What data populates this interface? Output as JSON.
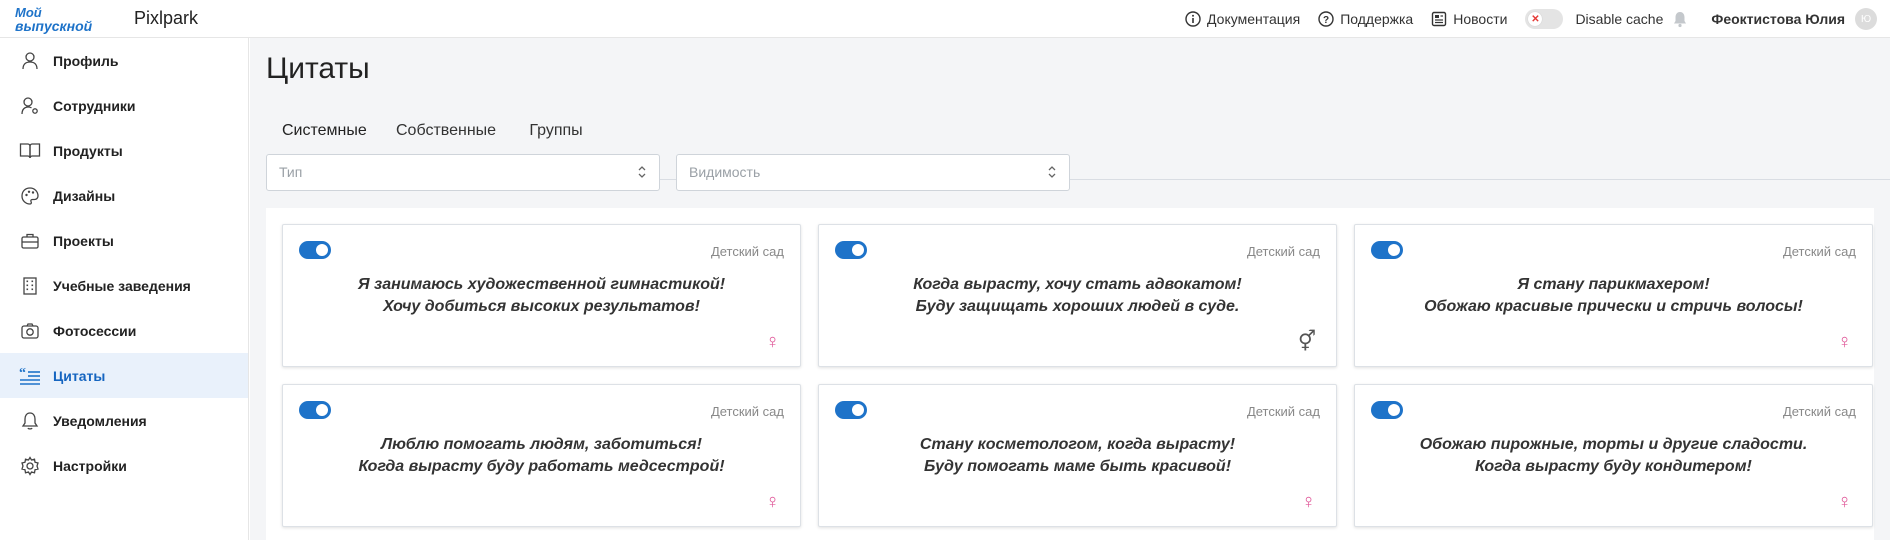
{
  "header": {
    "logo_line1": "Мой",
    "logo_line2": "выпускной",
    "app_name": "Pixlpark",
    "links": [
      {
        "label": "Документация",
        "icon": "info-icon"
      },
      {
        "label": "Поддержка",
        "icon": "help-icon"
      },
      {
        "label": "Новости",
        "icon": "news-icon"
      }
    ],
    "disable_cache_label": "Disable cache",
    "user_name": "Феоктистова Юлия",
    "avatar_initials": "Ю"
  },
  "sidebar": {
    "items": [
      {
        "label": "Профиль",
        "icon": "user-icon"
      },
      {
        "label": "Сотрудники",
        "icon": "user-settings-icon"
      },
      {
        "label": "Продукты",
        "icon": "book-icon"
      },
      {
        "label": "Дизайны",
        "icon": "palette-icon"
      },
      {
        "label": "Проекты",
        "icon": "briefcase-icon"
      },
      {
        "label": "Учебные заведения",
        "icon": "building-icon"
      },
      {
        "label": "Фотосессии",
        "icon": "camera-icon"
      },
      {
        "label": "Цитаты",
        "icon": "quote-icon",
        "active": true
      },
      {
        "label": "Уведомления",
        "icon": "bell-icon"
      },
      {
        "label": "Настройки",
        "icon": "gear-icon"
      }
    ]
  },
  "main": {
    "title": "Цитаты",
    "tabs": [
      {
        "label": "Системные",
        "active": true
      },
      {
        "label": "Собственные"
      },
      {
        "label": "Группы"
      }
    ],
    "filters": {
      "type_placeholder": "Тип",
      "visibility_placeholder": "Видимость"
    },
    "cards": [
      {
        "category": "Детский сад",
        "line1": "Я занимаюсь художественной гимнастикой!",
        "line2": "Хочу добиться высоких результатов!",
        "gender": "♀",
        "gender_name": "female",
        "enabled": true
      },
      {
        "category": "Детский сад",
        "line1": "Когда вырасту, хочу стать адвокатом!",
        "line2": "Буду защищать хороших людей в суде.",
        "gender": "⚥",
        "gender_name": "unisex",
        "enabled": true
      },
      {
        "category": "Детский сад",
        "line1": "Я стану парикмахером!",
        "line2": "Обожаю красивые прически и стричь волосы!",
        "gender": "♀",
        "gender_name": "female",
        "enabled": true
      },
      {
        "category": "Детский сад",
        "line1": "Люблю помогать людям, заботиться!",
        "line2": "Когда вырасту буду работать медсестрой!",
        "gender": "♀",
        "gender_name": "female",
        "enabled": true
      },
      {
        "category": "Детский сад",
        "line1": "Стану косметологом, когда вырасту!",
        "line2": "Буду помогать маме быть красивой!",
        "gender": "♀",
        "gender_name": "female",
        "enabled": true
      },
      {
        "category": "Детский сад",
        "line1": "Обожаю пирожные, торты и другие сладости.",
        "line2": "Когда вырасту буду кондитером!",
        "gender": "♀",
        "gender_name": "female",
        "enabled": true
      }
    ]
  },
  "colors": {
    "accent": "#1e73c9",
    "female": "#e05a9a",
    "unisex": "#555555"
  }
}
